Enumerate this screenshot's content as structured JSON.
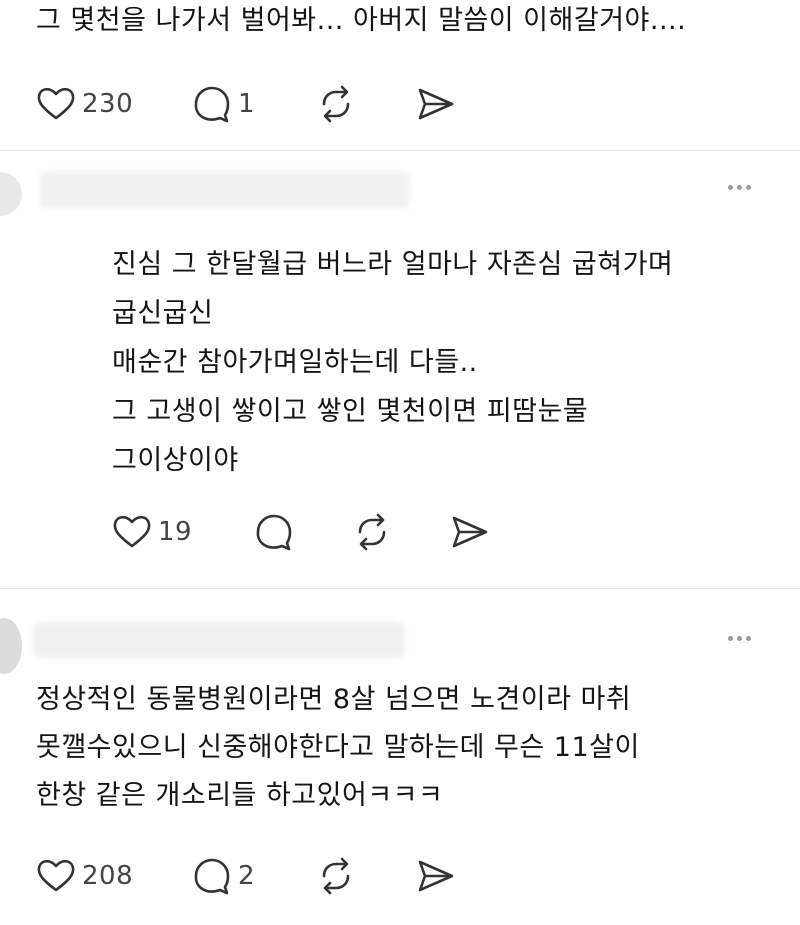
{
  "post_top": {
    "text": "그 몇천을 나가서 벌어봐... 아버지 말씀이 이해갈거야....",
    "likes": "230",
    "replies": "1"
  },
  "reply": {
    "lines": [
      "진심 그 한달월급 버느라 얼마나 자존심 굽혀가며",
      "굽신굽신",
      "매순간 참아가며일하는데 다들..",
      "그 고생이 쌓이고 쌓인 몇천이면 피땀눈물",
      "그이상이야"
    ],
    "likes": "19"
  },
  "post_bottom": {
    "lines": [
      "정상적인 동물병원이라면 8살 넘으면 노견이라 마취",
      "못깰수있으니 신중해야한다고 말하는데 무슨 11살이",
      "한창 같은 개소리들 하고있어ㅋㅋㅋ"
    ],
    "likes": "208",
    "replies": "2"
  },
  "icons": {
    "like": "heart-icon",
    "reply": "comment-bubble-icon",
    "repost": "repost-arrows-icon",
    "share": "send-paper-plane-icon",
    "more": "more-dots-icon"
  }
}
